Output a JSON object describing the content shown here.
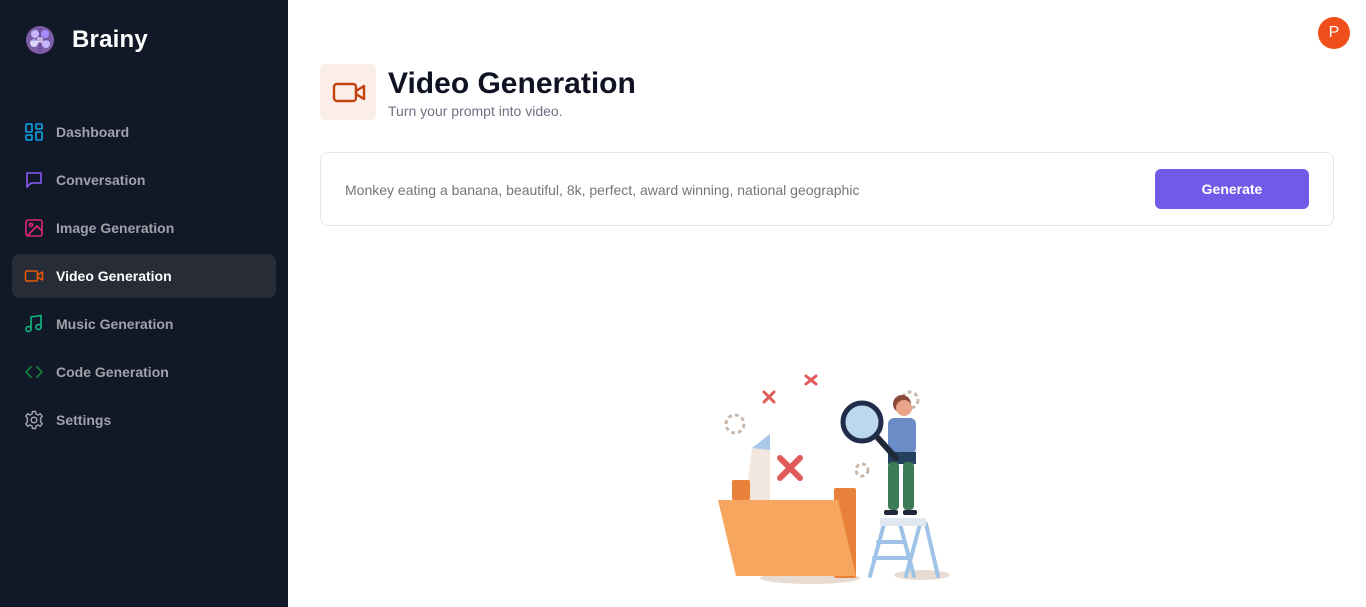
{
  "app": {
    "name": "Brainy"
  },
  "sidebar": {
    "items": [
      {
        "label": "Dashboard",
        "icon": "dashboard-icon",
        "color": "#0ea5e9",
        "active": false
      },
      {
        "label": "Conversation",
        "icon": "message-square-icon",
        "color": "#8b5cf6",
        "active": false
      },
      {
        "label": "Image Generation",
        "icon": "image-icon",
        "color": "#db2777",
        "active": false
      },
      {
        "label": "Video Generation",
        "icon": "video-icon",
        "color": "#ea580c",
        "active": true
      },
      {
        "label": "Music Generation",
        "icon": "music-icon",
        "color": "#10b981",
        "active": false
      },
      {
        "label": "Code Generation",
        "icon": "code-icon",
        "color": "#15803d",
        "active": false
      },
      {
        "label": "Settings",
        "icon": "settings-icon",
        "color": "#a1a1aa",
        "active": false
      }
    ]
  },
  "user": {
    "avatar_letter": "P",
    "avatar_color": "#f04e1a"
  },
  "page": {
    "title": "Video Generation",
    "subtitle": "Turn your prompt into video.",
    "icon": "video-icon",
    "accent": "#c2410c"
  },
  "prompt": {
    "placeholder": "Monkey eating a banana, beautiful, 8k, perfect, award winning, national geographic",
    "value": "",
    "button_label": "Generate",
    "button_color": "#6f5be8"
  },
  "empty_state": {
    "illustration": "empty-search-illustration"
  }
}
